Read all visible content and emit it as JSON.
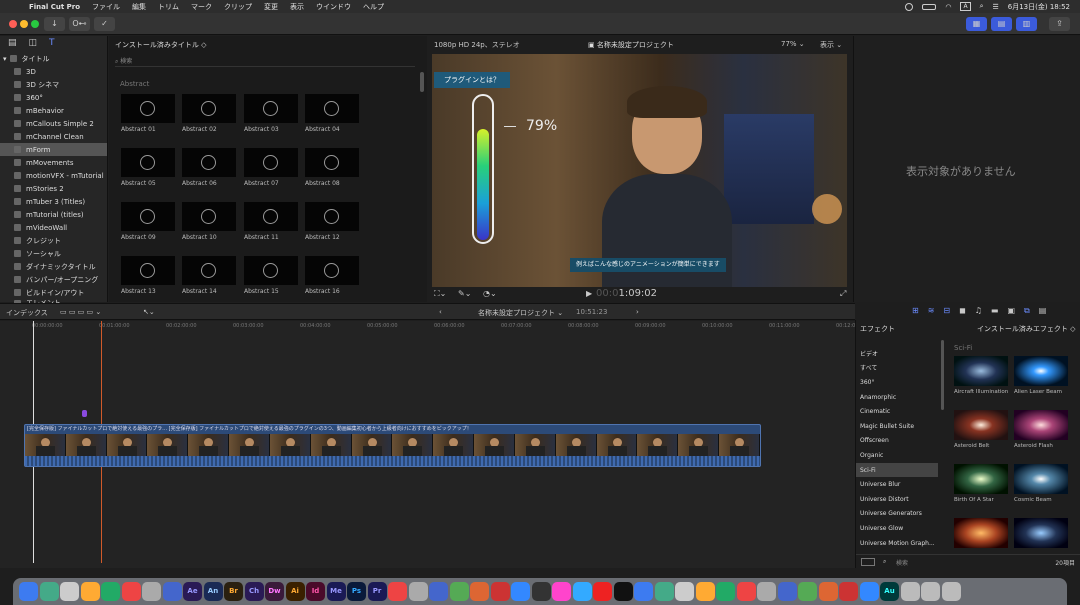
{
  "menubar": {
    "app": "Final Cut Pro",
    "items": [
      "ファイル",
      "編集",
      "トリム",
      "マーク",
      "クリップ",
      "変更",
      "表示",
      "ウインドウ",
      "ヘルプ"
    ],
    "clock": "6月13日(金) 18:52"
  },
  "toolbar": {
    "key_label": "O⊷"
  },
  "library": {
    "tree_root": "タイトル",
    "items": [
      "3D",
      "3D シネマ",
      "360°",
      "mBehavior",
      "mCallouts Simple 2",
      "mChannel Clean",
      "mForm",
      "mMovements",
      "motionVFX - mTutorial",
      "mStories 2",
      "mTuber 3 (Titles)",
      "mTutorial (titles)",
      "mVideoWall",
      "クレジット",
      "ソーシャル",
      "ダイナミックタイトル",
      "バンパー/オープニング",
      "ビルドイン/アウト",
      "エレメント"
    ],
    "selected": "mForm"
  },
  "browser": {
    "header": "インストール済みタイトル ◇",
    "search_placeholder": "検索",
    "section": "Abstract",
    "items": [
      "Abstract 01",
      "Abstract 02",
      "Abstract 03",
      "Abstract 04",
      "Abstract 05",
      "Abstract 06",
      "Abstract 07",
      "Abstract 08",
      "Abstract 09",
      "Abstract 10",
      "Abstract 11",
      "Abstract 12",
      "Abstract 13",
      "Abstract 14",
      "Abstract 15",
      "Abstract 16"
    ]
  },
  "viewer": {
    "format": "1080p HD 24p、ステレオ",
    "project": "名称未設定プロジェクト",
    "zoom": "77%",
    "display": "表示",
    "callout": "プラグインとは？",
    "meter_value": "79%",
    "meter_level": 0.79,
    "subtitle": "例えばこんな感じのアニメーションが簡単にできます",
    "timecode_dim": "00:0",
    "timecode": "1:09:02"
  },
  "inspector": {
    "empty": "表示対象がありません"
  },
  "timeline": {
    "index": "インデックス",
    "project": "名称未設定プロジェクト",
    "duration": "10:51:23",
    "ruler": [
      "00:00:00:00",
      "00:01:00:00",
      "00:02:00:00",
      "00:03:00:00",
      "00:04:00:00",
      "00:05:00:00",
      "00:06:00:00",
      "00:07:00:00",
      "00:08:00:00",
      "00:09:00:00",
      "00:10:00:00",
      "00:11:00:00",
      "00:12:00:00"
    ],
    "clip_label": "[完全保存版] ファイナルカットプロで絶対使える最強のプラ…   [完全保存版] ファイナルカットプロで絶対使える最強のプラグインの3つ、動画編集初心者から上級者向けにおすすめをピックアップ！"
  },
  "effects": {
    "header": "エフェクト",
    "installed": "インストール済みエフェクト ◇",
    "section": "Sci-Fi",
    "categories": [
      "ビデオ",
      "すべて",
      "360°",
      "Anamorphic",
      "Cinematic",
      "Magic Bullet Suite",
      "Offscreen",
      "Organic",
      "Sci-Fi",
      "Universe Blur",
      "Universe Distort",
      "Universe Generators",
      "Universe Glow",
      "Universe Motion Graph..."
    ],
    "selected": "Sci-Fi",
    "items": [
      "Aircraft Illumination",
      "Alien Laser Beam",
      "Asteroid Belt",
      "Asteroid Flash",
      "Birth Of A Star",
      "Cosmic Beam",
      "",
      ""
    ],
    "search_placeholder": "検索",
    "count": "20項目"
  },
  "dock": {
    "apps": [
      "Ae",
      "An",
      "Br",
      "Ch",
      "Dw",
      "Ai",
      "Id",
      "Me",
      "Ps",
      "Pr",
      "Au"
    ]
  }
}
